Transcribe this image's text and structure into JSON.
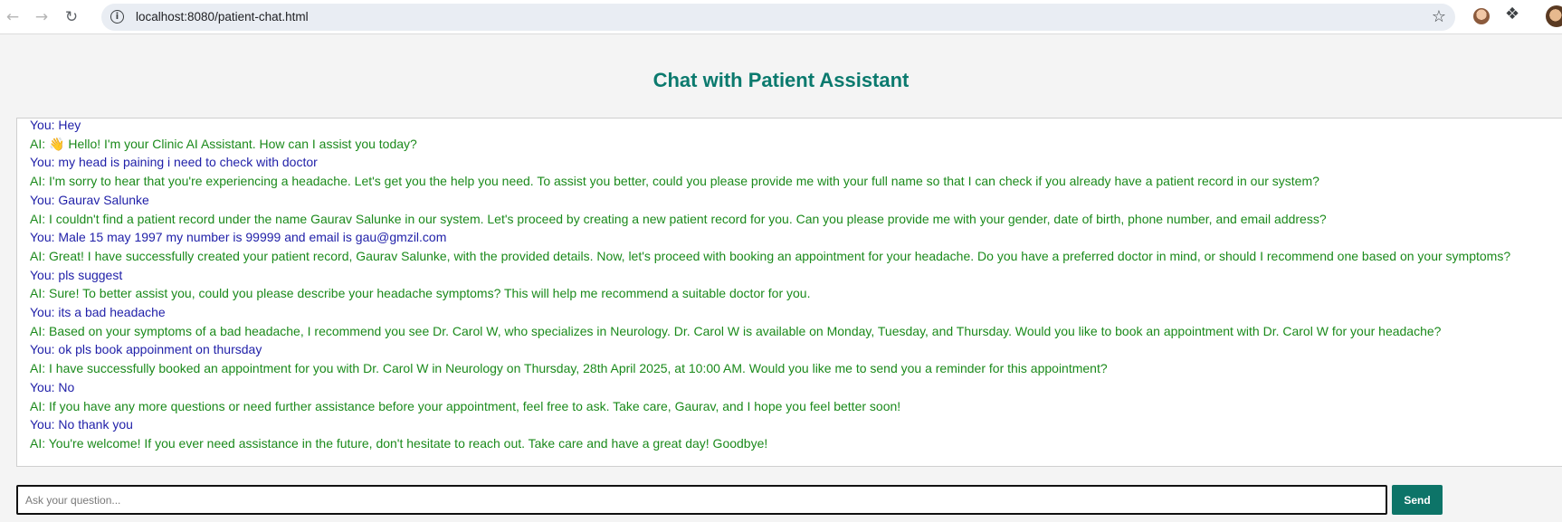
{
  "browser": {
    "url": "localhost:8080/patient-chat.html",
    "back_icon": "←",
    "forward_icon": "→",
    "reload_icon": "↻",
    "info_icon": "i",
    "star_icon": "☆",
    "extensions_icon": "❖"
  },
  "page": {
    "title": "Chat with Patient Assistant"
  },
  "chat": {
    "messages": [
      {
        "role": "user",
        "text": "You: Hey"
      },
      {
        "role": "ai",
        "text": "AI: 👋 Hello! I'm your Clinic AI Assistant. How can I assist you today?"
      },
      {
        "role": "user",
        "text": "You: my head is paining i need to check with doctor"
      },
      {
        "role": "ai",
        "text": "AI: I'm sorry to hear that you're experiencing a headache. Let's get you the help you need. To assist you better, could you please provide me with your full name so that I can check if you already have a patient record in our system?"
      },
      {
        "role": "user",
        "text": "You: Gaurav Salunke"
      },
      {
        "role": "ai",
        "text": "AI: I couldn't find a patient record under the name Gaurav Salunke in our system. Let's proceed by creating a new patient record for you. Can you please provide me with your gender, date of birth, phone number, and email address?"
      },
      {
        "role": "user",
        "text": "You: Male 15 may 1997 my number is 99999 and email is gau@gmzil.com"
      },
      {
        "role": "ai",
        "text": "AI: Great! I have successfully created your patient record, Gaurav Salunke, with the provided details. Now, let's proceed with booking an appointment for your headache. Do you have a preferred doctor in mind, or should I recommend one based on your symptoms?"
      },
      {
        "role": "user",
        "text": "You: pls suggest"
      },
      {
        "role": "ai",
        "text": "AI: Sure! To better assist you, could you please describe your headache symptoms? This will help me recommend a suitable doctor for you."
      },
      {
        "role": "user",
        "text": "You: its a bad headache"
      },
      {
        "role": "ai",
        "text": "AI: Based on your symptoms of a bad headache, I recommend you see Dr. Carol W, who specializes in Neurology. Dr. Carol W is available on Monday, Tuesday, and Thursday. Would you like to book an appointment with Dr. Carol W for your headache?"
      },
      {
        "role": "user",
        "text": "You: ok pls book appoinment on thursday"
      },
      {
        "role": "ai",
        "text": "AI: I have successfully booked an appointment for you with Dr. Carol W in Neurology on Thursday, 28th April 2025, at 10:00 AM. Would you like me to send you a reminder for this appointment?"
      },
      {
        "role": "user",
        "text": "You: No"
      },
      {
        "role": "ai",
        "text": "AI: If you have any more questions or need further assistance before your appointment, feel free to ask. Take care, Gaurav, and I hope you feel better soon!"
      },
      {
        "role": "user",
        "text": "You: No thank you"
      },
      {
        "role": "ai",
        "text": "AI: You're welcome! If you ever need assistance in the future, don't hesitate to reach out. Take care and have a great day! Goodbye!"
      }
    ]
  },
  "input": {
    "placeholder": "Ask your question...",
    "value": ""
  },
  "send_button": {
    "label": "Send"
  },
  "colors": {
    "title": "#0b7a6e",
    "user_text": "#1f1fa8",
    "ai_text": "#1b8a1b",
    "send_button": "#0d7468"
  }
}
